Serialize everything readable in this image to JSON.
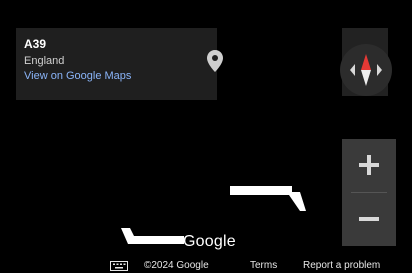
{
  "place_card": {
    "title": "A39",
    "region": "England",
    "link_label": "View on Google Maps"
  },
  "icons": {
    "pin": "map-pin-icon",
    "compass": "compass-icon",
    "zoom_in": "plus-icon",
    "zoom_out": "minus-icon",
    "keyboard": "keyboard-icon"
  },
  "zoom": {
    "in_label": "+",
    "out_label": "−"
  },
  "logo": {
    "text": "Google"
  },
  "footer": {
    "copyright": "©2024 Google",
    "terms": "Terms",
    "report": "Report a problem"
  },
  "colors": {
    "map_background": "#000000",
    "card_background": "#1f1f1f",
    "link": "#8ab4f8",
    "road": "#ffffff",
    "compass_north": "#e53935"
  }
}
